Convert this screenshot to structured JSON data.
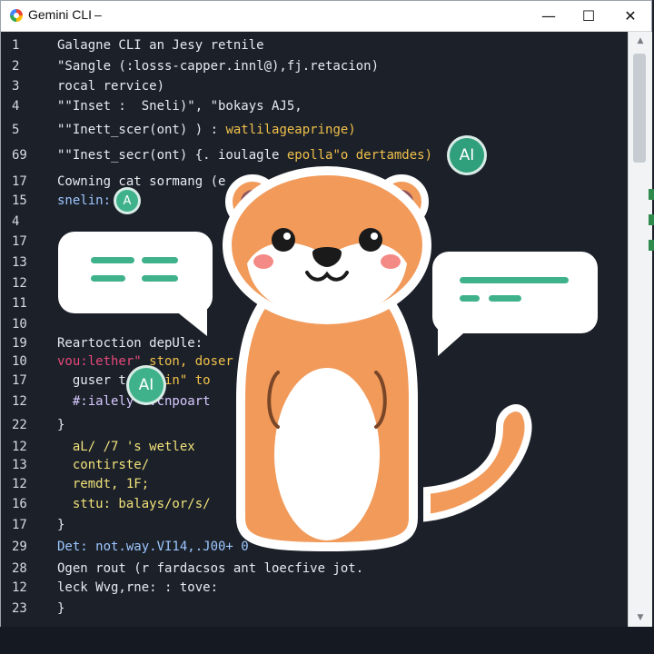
{
  "window": {
    "title": "Gemini CLI",
    "title_dash": "–",
    "controls": {
      "minimize": "—",
      "maximize": "☐",
      "close": "✕"
    }
  },
  "editor": {
    "lines": [
      {
        "n": "1",
        "text": "Galagne CLI an Jesy retnile"
      },
      {
        "n": "2",
        "text": "\"Sangle (:losss-capper.innl@),fj.retacion)"
      },
      {
        "n": "3",
        "text": "rocal rervice)"
      },
      {
        "n": "4",
        "text": "\"\"Inset :  Sneli)\", \"bokays AJ5,"
      },
      {
        "n": "5",
        "text": "\"\"Inett_scer(ont) ) :",
        "accent": " watlilageapringe)"
      },
      {
        "n": "69",
        "text": "\"\"Inest_secr(ont) {. ioulagle",
        "accent": " epolla\"o dertamdes)"
      },
      {
        "n": "17",
        "text": "Cowning cat sormang (e"
      },
      {
        "n": "15",
        "text": "snelin:"
      },
      {
        "n": "4",
        "text": ""
      },
      {
        "n": "17",
        "text": ""
      },
      {
        "n": "13",
        "text": ""
      },
      {
        "n": "12",
        "text": ""
      },
      {
        "n": "11",
        "text": ""
      },
      {
        "n": "10",
        "text": ""
      },
      {
        "n": "19",
        "text": "Reartoction depUle:"
      },
      {
        "n": "10",
        "text": "vou:lether\"",
        "accent": " ston, doser"
      },
      {
        "n": "17",
        "text": "  guser t",
        "accent": "     in\" to"
      },
      {
        "n": "12",
        "text": "  #:ialely e:cnpoart"
      },
      {
        "n": "22",
        "text": "}"
      },
      {
        "n": "12",
        "text": "  aL/ /7 's wetlex"
      },
      {
        "n": "13",
        "text": "  contirste/"
      },
      {
        "n": "12",
        "text": "  remdt, 1F;"
      },
      {
        "n": "16",
        "text": "  sttu: balays/or/s/"
      },
      {
        "n": "17",
        "text": "}"
      },
      {
        "n": "29",
        "text": "Det: not.way.VI14,.J00+ 0"
      },
      {
        "n": "28",
        "text": "Ogen rout (r fardacsos ant loecfive jot."
      },
      {
        "n": "12",
        "text": "leck Wvg,rne: : tove:"
      },
      {
        "n": "23",
        "text": "}"
      }
    ]
  },
  "badges": {
    "ai_top": "AI",
    "ai_mid": "AI",
    "a_small": "A"
  },
  "colors": {
    "accent_green": "#3fb28c",
    "mascot_orange": "#f19a5a",
    "editor_bg": "#1b2029"
  },
  "icons": {
    "app": "gemini-logo-icon",
    "mascot": "otter-mascot-icon"
  }
}
